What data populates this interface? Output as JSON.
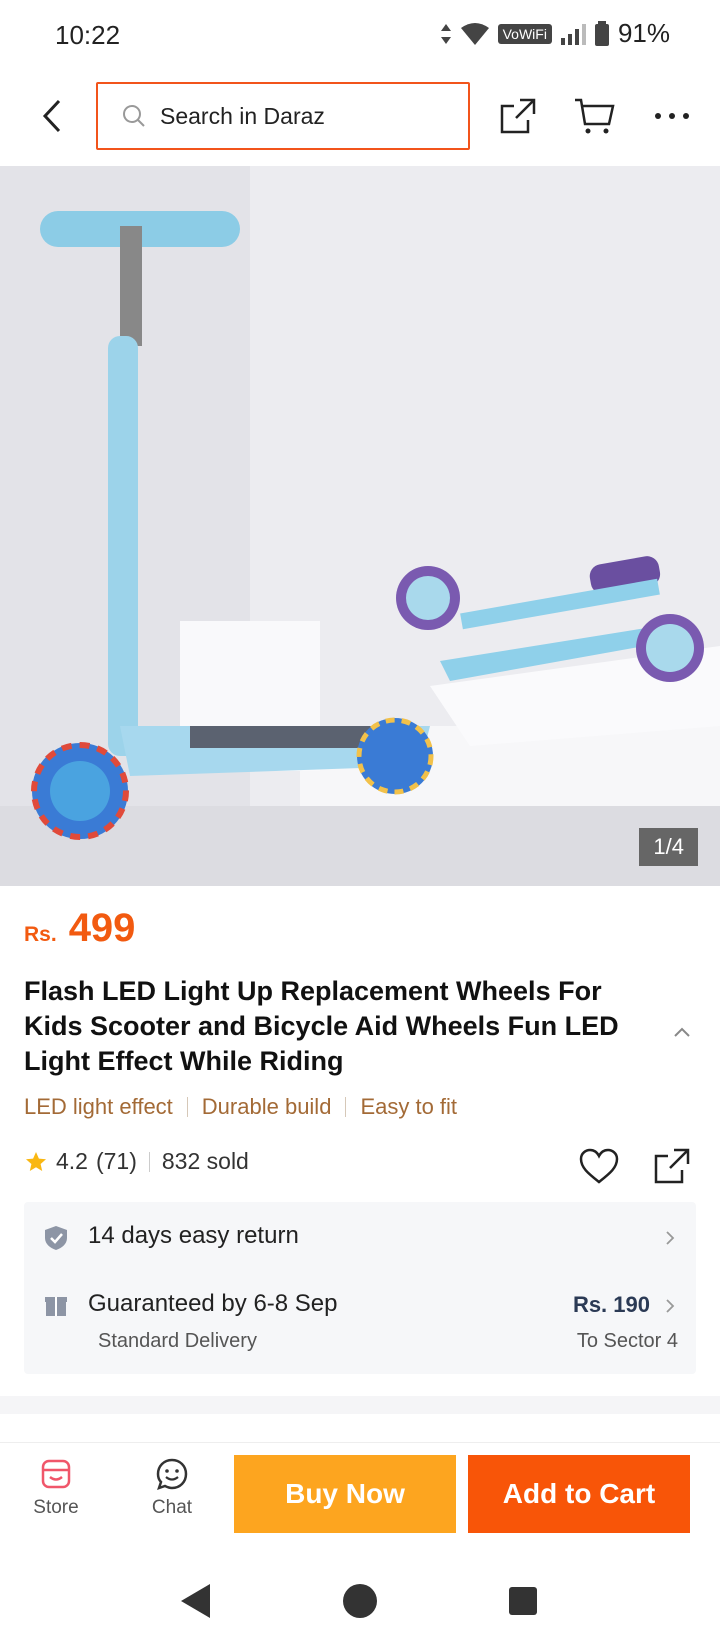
{
  "status_bar": {
    "time": "10:22",
    "network_label": "VoWiFi",
    "battery": "91%"
  },
  "top_nav": {
    "search_placeholder": "Search in Daraz"
  },
  "product": {
    "image_counter": "1/4",
    "price_currency": "Rs.",
    "price_value": "499",
    "title": "Flash LED Light Up Replacement Wheels For Kids Scooter and Bicycle Aid Wheels Fun LED Light Effect While Riding",
    "features": [
      "LED light effect",
      "Durable build",
      "Easy to fit"
    ],
    "rating": "4.2",
    "rating_count": "(71)",
    "sold": "832 sold"
  },
  "services": {
    "return_text": "14 days easy return",
    "delivery_text": "Guaranteed by 6-8 Sep",
    "delivery_type": "Standard Delivery",
    "delivery_price": "Rs. 190",
    "delivery_destination": "To Sector 4"
  },
  "bottom_bar": {
    "store_label": "Store",
    "chat_label": "Chat",
    "buy_now_label": "Buy Now",
    "add_to_cart_label": "Add to Cart"
  },
  "colors": {
    "accent_orange": "#f85508",
    "buy_now_yellow": "#fda51f",
    "feature_brown": "#a36a36",
    "star_yellow": "#f9b712"
  }
}
